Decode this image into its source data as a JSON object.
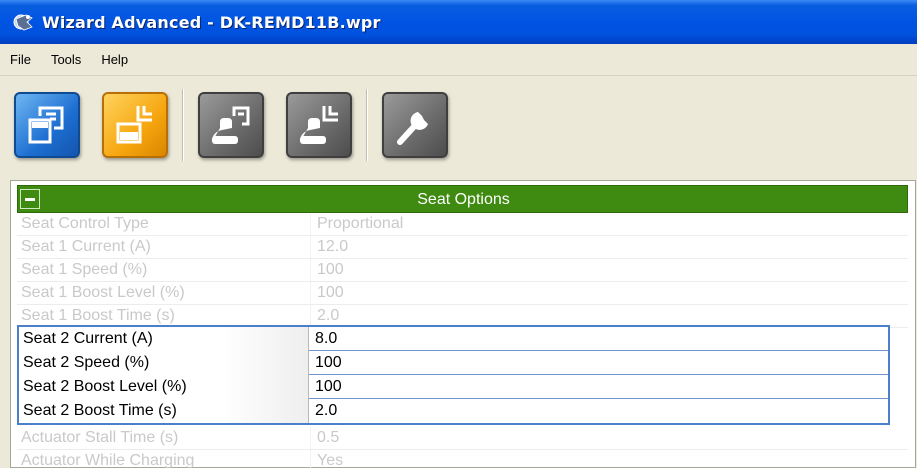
{
  "window": {
    "title": "Wizard Advanced - DK-REMD11B.wpr"
  },
  "menu": {
    "items": [
      "File",
      "Tools",
      "Help"
    ]
  },
  "toolbar": {
    "buttons": [
      {
        "icon": "read-from-device-icon",
        "color": "#1c6ed1"
      },
      {
        "icon": "write-to-device-icon",
        "color": "#f6a60f"
      },
      {
        "icon": "read-from-chair-icon",
        "color": "#6a6a6a"
      },
      {
        "icon": "write-to-chair-icon",
        "color": "#6a6a6a"
      },
      {
        "icon": "wrench-settings-icon",
        "color": "#6a6a6a"
      }
    ]
  },
  "section": {
    "title": "Seat Options",
    "header_color": "#3f8a10"
  },
  "upper_rows": [
    {
      "label": "Seat Control Type",
      "value": "Proportional"
    },
    {
      "label": "Seat 1 Current (A)",
      "value": "12.0"
    },
    {
      "label": "Seat 1 Speed (%)",
      "value": "100"
    },
    {
      "label": "Seat 1 Boost Level (%)",
      "value": "100"
    },
    {
      "label": "Seat 1 Boost Time (s)",
      "value": "2.0"
    }
  ],
  "active_rows": [
    {
      "label": "Seat 2 Current (A)",
      "value": "8.0"
    },
    {
      "label": "Seat 2 Speed (%)",
      "value": "100"
    },
    {
      "label": "Seat 2 Boost Level (%)",
      "value": "100"
    },
    {
      "label": "Seat 2 Boost Time (s)",
      "value": "2.0"
    }
  ],
  "lower_rows": [
    {
      "label": "Actuator Stall Time (s)",
      "value": "0.5"
    },
    {
      "label": "Actuator While Charging",
      "value": "Yes"
    }
  ]
}
